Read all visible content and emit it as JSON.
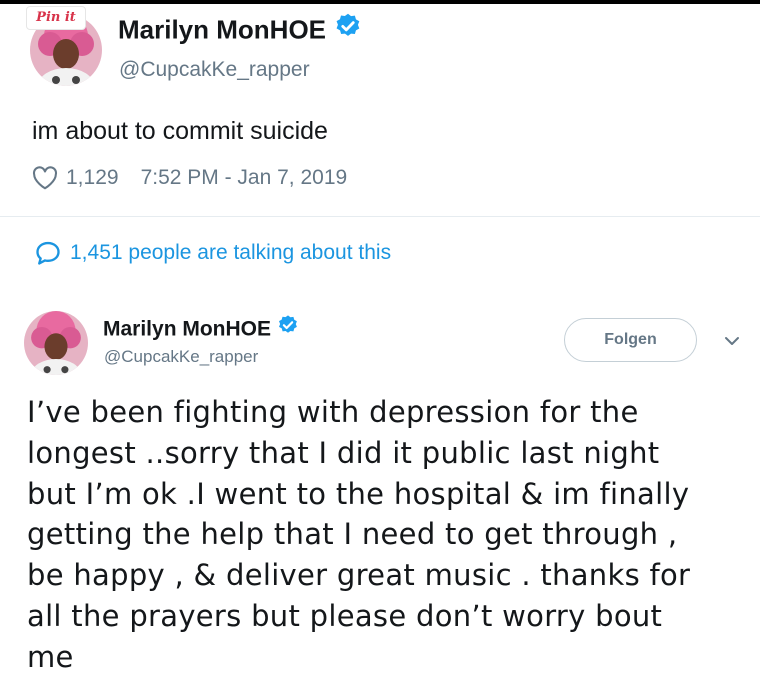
{
  "pin_badge": "Pin it",
  "tweet1": {
    "name": "Marilyn MonHOE",
    "handle": "@CupcakKe_rapper",
    "text": "im about to commit suicide",
    "likes": "1,129",
    "timestamp": "7:52 PM - Jan 7, 2019",
    "talking": "1,451 people are talking about this"
  },
  "tweet2": {
    "name": "Marilyn MonHOE",
    "handle": "@CupcakKe_rapper",
    "follow_label": "Folgen",
    "text": "I’ve been fighting with depression for the\nlongest ..sorry that I did it public last night\nbut I’m ok .I went to the hospital & im finally\ngetting the help that I need to get through ,\nbe happy , & deliver great music . thanks for\nall the prayers but please don’t worry bout\nme"
  },
  "icons": {
    "verified": "verified-badge-icon",
    "like": "heart-icon",
    "reply": "speech-bubble-icon",
    "caret": "chevron-down-icon"
  },
  "colors": {
    "text": "#14171a",
    "muted": "#657786",
    "link": "#1b95e0",
    "verified": "#1da1f2",
    "divider": "#e6ecf0",
    "pin": "#d8334a"
  }
}
